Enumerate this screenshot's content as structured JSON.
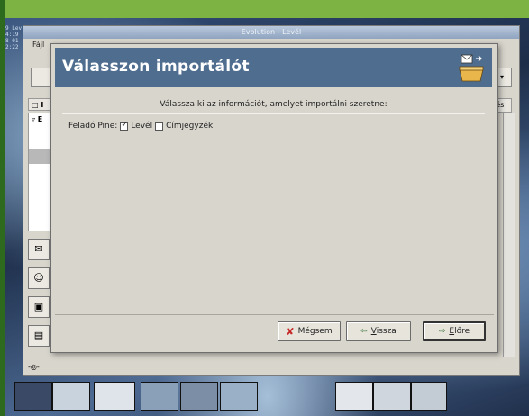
{
  "desktop": {
    "corner_text": [
      "9 Lev",
      "4:19",
      "8 01",
      "2:22"
    ]
  },
  "evolution": {
    "window_title": "Evolution - Levél",
    "menu": "Fájl",
    "column_left": "□ I",
    "column_right": "rlés",
    "tree_item": "▿ E",
    "toolbar_more": "▾"
  },
  "dialog": {
    "title": "Válasszon importálót",
    "prompt": "Válassza ki az információt, amelyet importálni szeretne:",
    "row_label": "Feladó Pine:",
    "options": [
      {
        "label": "Levél",
        "checked": true
      },
      {
        "label": "Címjegyzék",
        "checked": false
      }
    ],
    "buttons": {
      "cancel": "Mégsem",
      "back_prefix": "",
      "back_mnemonic": "V",
      "back_rest": "issza",
      "forward_mnemonic": "E",
      "forward_rest": "lőre"
    }
  },
  "colors": {
    "header_bg": "#4f6d8f",
    "top_banner": "#7cb342",
    "dialog_bg": "#d8d5cc"
  }
}
